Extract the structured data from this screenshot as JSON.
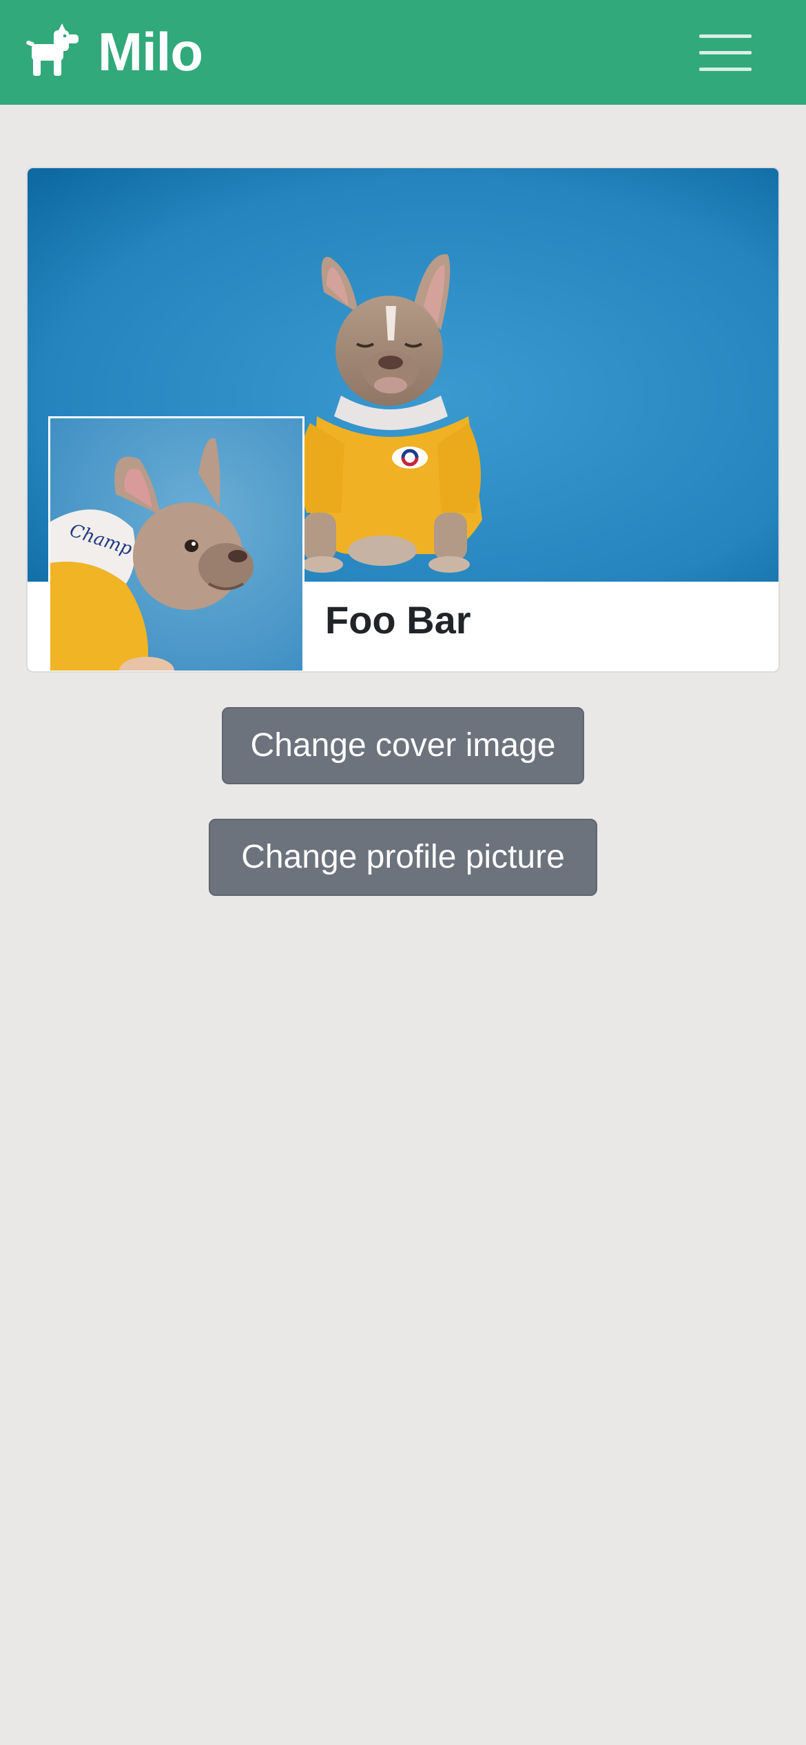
{
  "app": {
    "title": "Milo",
    "logo_icon": "dog-icon",
    "menu_icon": "hamburger-menu-icon",
    "brand_color": "#31a97b"
  },
  "profile": {
    "name": "Foo Bar",
    "cover_image": "french-bulldog-yellow-shirt-blue-background",
    "profile_image": "french-bulldog-yellow-hoodie-side-view"
  },
  "actions": {
    "change_cover": "Change cover image",
    "change_profile": "Change profile picture"
  },
  "colors": {
    "background": "#eae8e6",
    "button": "#6c737d",
    "cover_blue": "#2b86bd"
  }
}
